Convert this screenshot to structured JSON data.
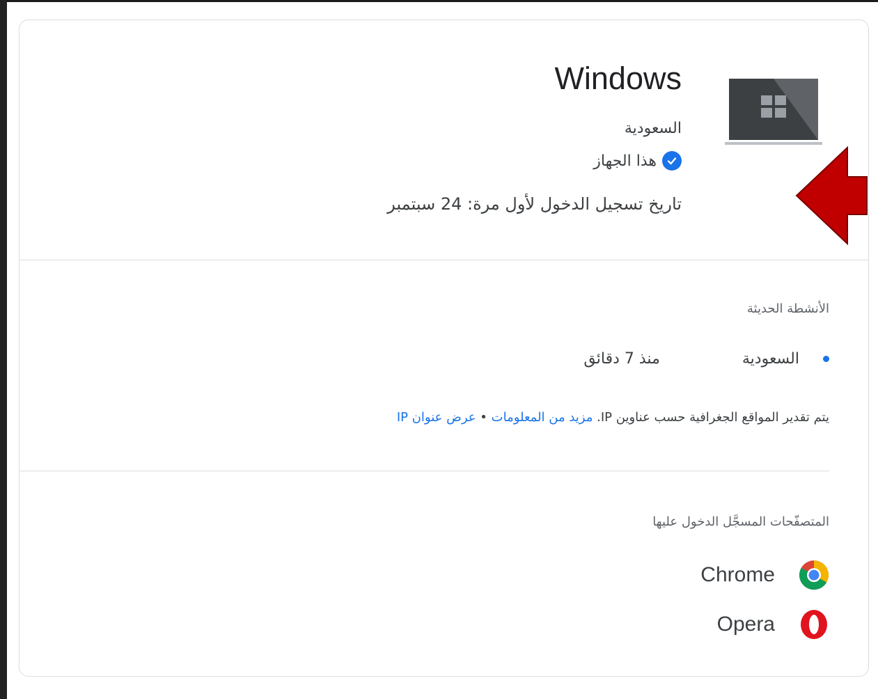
{
  "device": {
    "name": "Windows",
    "country": "السعودية",
    "this_device_label": "هذا الجهاز",
    "first_signin": "تاريخ تسجيل الدخول لأول مرة: 24 سبتمبر",
    "icon": "windows-laptop-icon"
  },
  "recent_activity": {
    "title": "الأنشطة الحديثة",
    "items": [
      {
        "country": "السعودية",
        "time": "منذ 7 دقائق"
      }
    ],
    "note_prefix": "يتم تقدير المواقع الجغرافية حسب عناوين IP.",
    "learn_more_link": "مزيد من المعلومات",
    "separator": "•",
    "view_ip_link": "عرض عنوان IP"
  },
  "browsers": {
    "title": "المتصفّحات المسجَّل الدخول عليها",
    "items": [
      {
        "name": "Chrome",
        "icon": "chrome-icon"
      },
      {
        "name": "Opera",
        "icon": "opera-icon"
      }
    ]
  },
  "colors": {
    "accent": "#1a73e8",
    "arrow": "#c00000"
  }
}
